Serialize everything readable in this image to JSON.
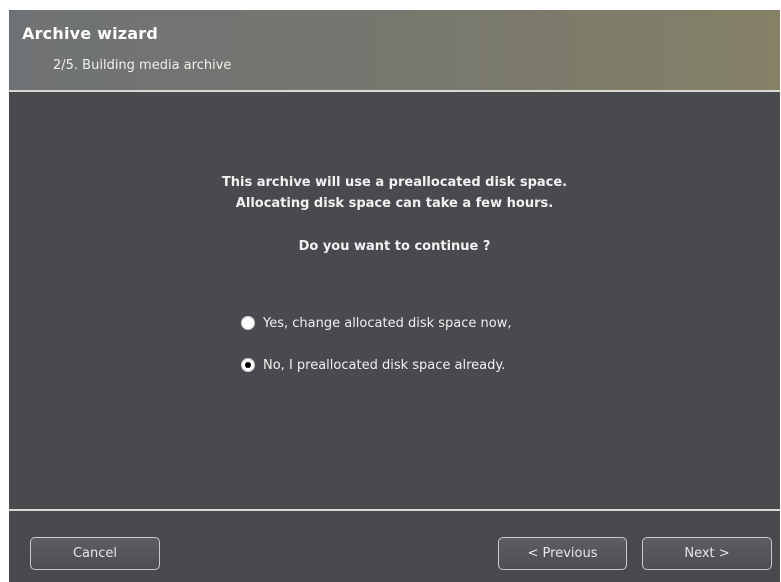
{
  "window": {
    "title": "Archive wizard",
    "step": "2/5. Building media archive"
  },
  "message": {
    "line1": "This archive will use a preallocated disk space.",
    "line2": "Allocating disk space can take a few hours.",
    "question": "Do you want to continue ?"
  },
  "options": [
    {
      "label": "Yes, change allocated disk space now,",
      "selected": false
    },
    {
      "label": "No, I preallocated disk space already.",
      "selected": true
    }
  ],
  "buttons": {
    "cancel": "Cancel",
    "previous": "< Previous",
    "next": "Next >"
  },
  "colors": {
    "panel_background": "#484a4e",
    "header_background": "#75766f",
    "text": "#f2f2f2",
    "divider": "#d8d8d4"
  }
}
